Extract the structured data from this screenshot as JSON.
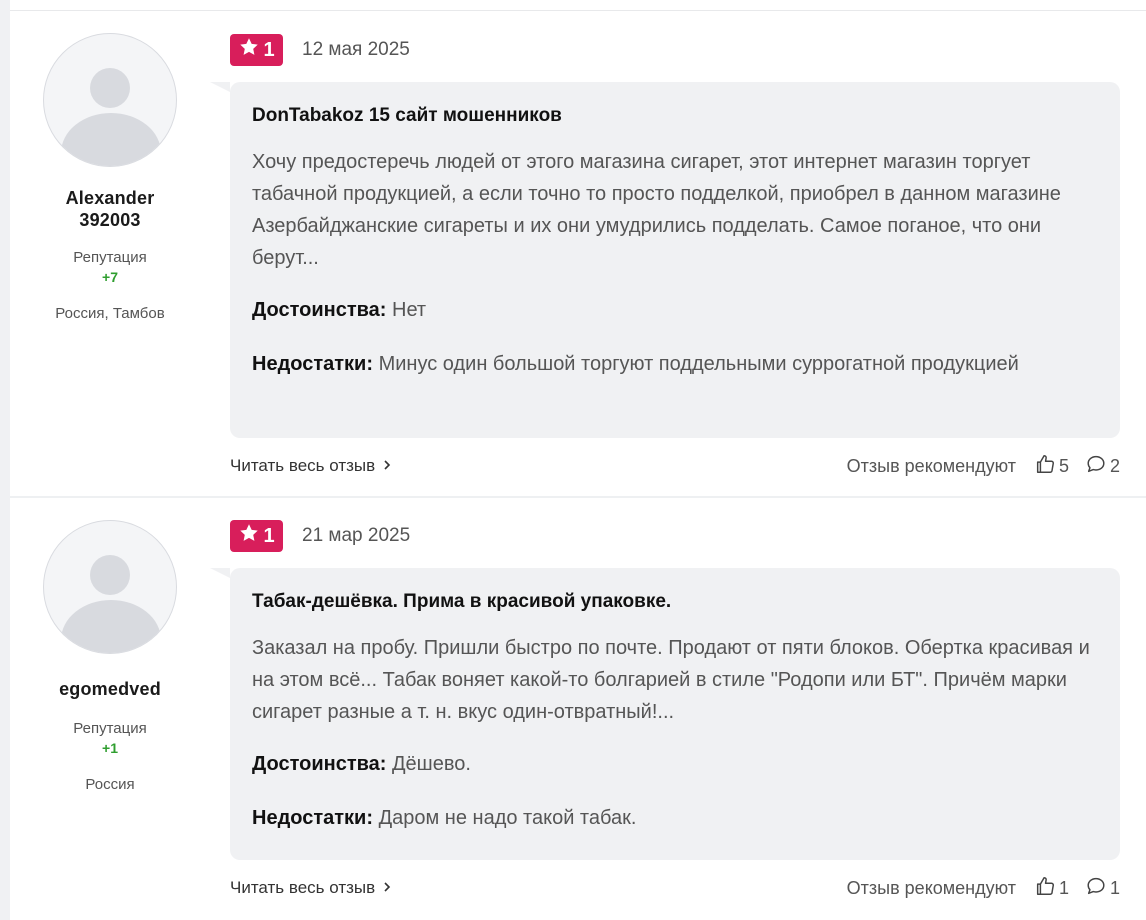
{
  "reviews": [
    {
      "author": {
        "name_line1": "Alexander",
        "name_line2": "392003",
        "rep_label": "Репутация",
        "rep_value": "+7",
        "location": "Россия, Тамбов"
      },
      "rating": "1",
      "date": "12 мая 2025",
      "title": "DonTabakoz 15 сайт мошенников",
      "text": "Хочу предостеречь людей от этого магазина сигарет, этот интернет магазин торгует табачной продукцией, а если точно то просто подделкой, приобрел в данном магазине Азербайджанские сигареты и их они умудрились подделать. Самое поганое, что они берут...",
      "pros_label": "Достоинства:",
      "pros": "Нет",
      "cons_label": "Недостатки:",
      "cons": "Минус один большой торгуют поддельными суррогатной продукцией",
      "read_more": "Читать весь отзыв",
      "recommend_label": "Отзыв рекомендуют",
      "likes": "5",
      "comments": "2"
    },
    {
      "author": {
        "name_line1": "egomedved",
        "name_line2": "",
        "rep_label": "Репутация",
        "rep_value": "+1",
        "location": "Россия"
      },
      "rating": "1",
      "date": "21 мар 2025",
      "title": "Табак-дешёвка. Прима в красивой упаковке.",
      "text": "Заказал на пробу. Пришли быстро по почте. Продают от пяти блоков. Обертка красивая и на этом всё... Табак воняет какой-то болгарией в стиле \"Родопи или БТ\". Причём марки сигарет разные а т. н. вкус один-отвратный!...",
      "pros_label": "Достоинства:",
      "pros": "Дёшево.",
      "cons_label": "Недостатки:",
      "cons": "Даром не надо такой табак.",
      "read_more": "Читать весь отзыв",
      "recommend_label": "Отзыв рекомендуют",
      "likes": "1",
      "comments": "1"
    }
  ],
  "colors": {
    "badge": "#d81e5b",
    "reputation": "#2f9e2f",
    "card_bg": "#f0f1f3"
  },
  "icons": {
    "rating": "star-icon",
    "read_more": "chevron-right-icon",
    "likes": "thumbs-up-icon",
    "comments": "comment-bubble-icon"
  }
}
